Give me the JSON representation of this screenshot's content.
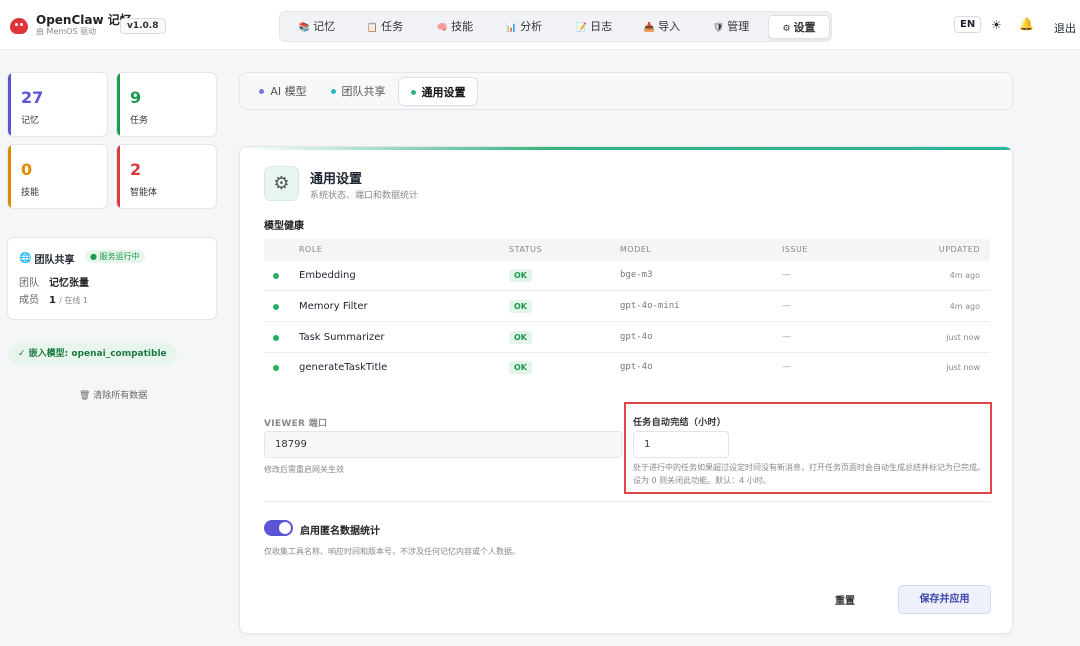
{
  "brand": {
    "name": "OpenClaw 记忆",
    "sub": "由 MemOS 驱动",
    "version": "v1.0.8"
  },
  "nav": [
    {
      "icon": "📚",
      "label": "记忆"
    },
    {
      "icon": "📋",
      "label": "任务"
    },
    {
      "icon": "🧠",
      "label": "技能"
    },
    {
      "icon": "📊",
      "label": "分析"
    },
    {
      "icon": "📝",
      "label": "日志"
    },
    {
      "icon": "📥",
      "label": "导入"
    },
    {
      "icon": "🛡",
      "label": "管理"
    },
    {
      "icon": "⚙",
      "label": "设置"
    }
  ],
  "nav_active": "设置",
  "top_right": {
    "lang": "EN",
    "sun": "☀",
    "bell": "🔔",
    "logout": "退出"
  },
  "stats": [
    {
      "value": "27",
      "label": "记忆",
      "color": "#5b55d6"
    },
    {
      "value": "9",
      "label": "任务",
      "color": "#1a9a4a"
    },
    {
      "value": "0",
      "label": "技能",
      "color": "#e08a00"
    },
    {
      "value": "2",
      "label": "智能体",
      "color": "#d93a3a"
    }
  ],
  "team": {
    "title": "团队共享",
    "status": "● 服务运行中",
    "team_label": "团队",
    "team_name": "记忆张量",
    "members_label": "成员",
    "members_value": "1",
    "online": "/ 在线 1"
  },
  "embed_pill": "✓ 嵌入模型: openai_compatible",
  "clear_data": "🗑 清除所有数据",
  "subtabs": [
    {
      "label": "AI 模型",
      "dot": "#7a74e0"
    },
    {
      "label": "团队共享",
      "dot": "#2bb5c8"
    },
    {
      "label": "通用设置",
      "dot": "#36b37e"
    }
  ],
  "panel": {
    "title": "通用设置",
    "subtitle": "系统状态、端口和数据统计",
    "health_label": "模型健康",
    "columns": [
      "ROLE",
      "STATUS",
      "MODEL",
      "ISSUE",
      "UPDATED"
    ],
    "rows": [
      {
        "role": "Embedding",
        "status": "OK",
        "model": "bge-m3",
        "issue": "—",
        "updated": "4m ago"
      },
      {
        "role": "Memory Filter",
        "status": "OK",
        "model": "gpt-4o-mini",
        "issue": "—",
        "updated": "4m ago"
      },
      {
        "role": "Task Summarizer",
        "status": "OK",
        "model": "gpt-4o",
        "issue": "—",
        "updated": "just now"
      },
      {
        "role": "generateTaskTitle",
        "status": "OK",
        "model": "gpt-4o",
        "issue": "—",
        "updated": "just now"
      }
    ],
    "viewer_port_label": "VIEWER 端口",
    "viewer_port_value": "18799",
    "viewer_port_hint": "修改后需重启网关生效",
    "auto_finish_label": "任务自动完结（小时）",
    "auto_finish_value": "1",
    "auto_finish_hint": "处于进行中的任务如果超过设定时间没有新消息，打开任务页面时会自动生成总结并标记为已完成。设为 0 则关闭此功能。默认：4 小时。",
    "telemetry_label": "启用匿名数据统计",
    "telemetry_hint": "仅收集工具名称、响应时间和版本号，不涉及任何记忆内容或个人数据。",
    "telemetry_enabled": true,
    "reset_label": "重置",
    "save_label": "保存并应用"
  }
}
